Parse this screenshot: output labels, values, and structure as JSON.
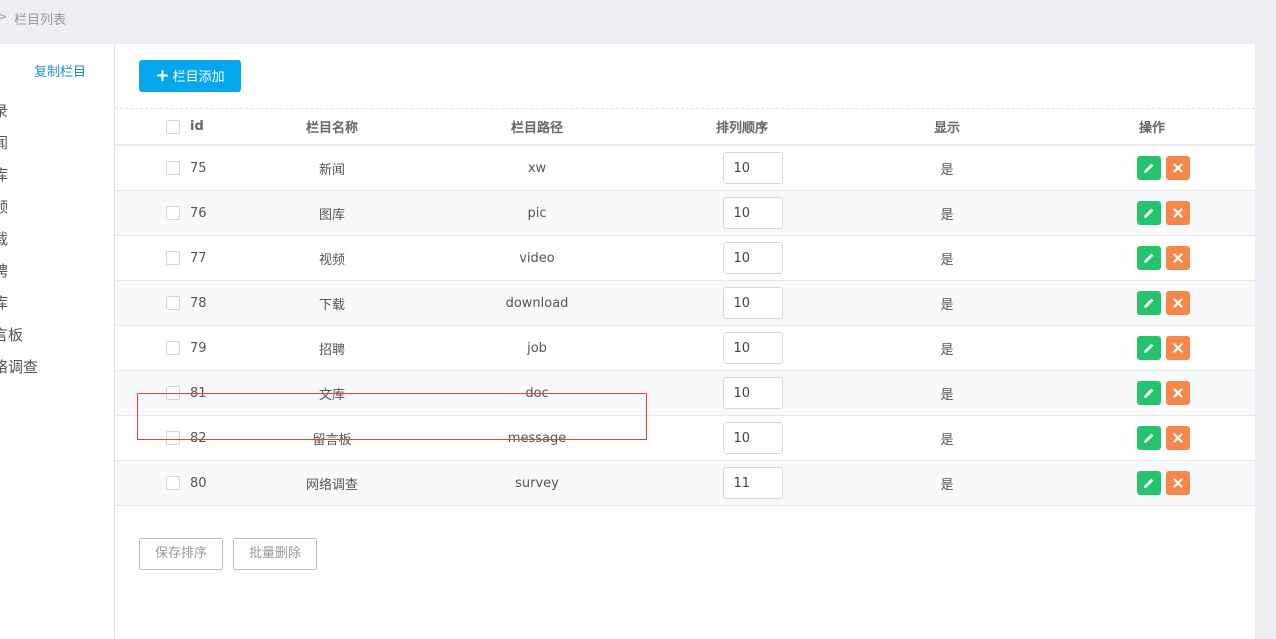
{
  "breadcrumb": {
    "current": "栏目列表"
  },
  "sidebar": {
    "copy_link": "复制栏目",
    "tree_items": [
      "录",
      "闻",
      "库",
      "频",
      "载",
      "聘",
      "库",
      "言板",
      "络调查"
    ]
  },
  "toolbar": {
    "add_label": "栏目添加"
  },
  "table": {
    "headers": {
      "id": "id",
      "name": "栏目名称",
      "path": "栏目路径",
      "order": "排列顺序",
      "show": "显示",
      "ops": "操作"
    },
    "rows": [
      {
        "id": "75",
        "name": "新闻",
        "path": "xw",
        "order": "10",
        "show": "是"
      },
      {
        "id": "76",
        "name": "图库",
        "path": "pic",
        "order": "10",
        "show": "是"
      },
      {
        "id": "77",
        "name": "视频",
        "path": "video",
        "order": "10",
        "show": "是"
      },
      {
        "id": "78",
        "name": "下载",
        "path": "download",
        "order": "10",
        "show": "是"
      },
      {
        "id": "79",
        "name": "招聘",
        "path": "job",
        "order": "10",
        "show": "是"
      },
      {
        "id": "81",
        "name": "文库",
        "path": "doc",
        "order": "10",
        "show": "是"
      },
      {
        "id": "82",
        "name": "留言板",
        "path": "message",
        "order": "10",
        "show": "是"
      },
      {
        "id": "80",
        "name": "网络调查",
        "path": "survey",
        "order": "11",
        "show": "是"
      }
    ]
  },
  "footer": {
    "save_label": "保存排序",
    "batch_delete_label": "批量删除"
  },
  "colors": {
    "primary": "#07a7ee",
    "edit": "#23c46c",
    "delete": "#f7864a",
    "highlight": "#e04040"
  }
}
